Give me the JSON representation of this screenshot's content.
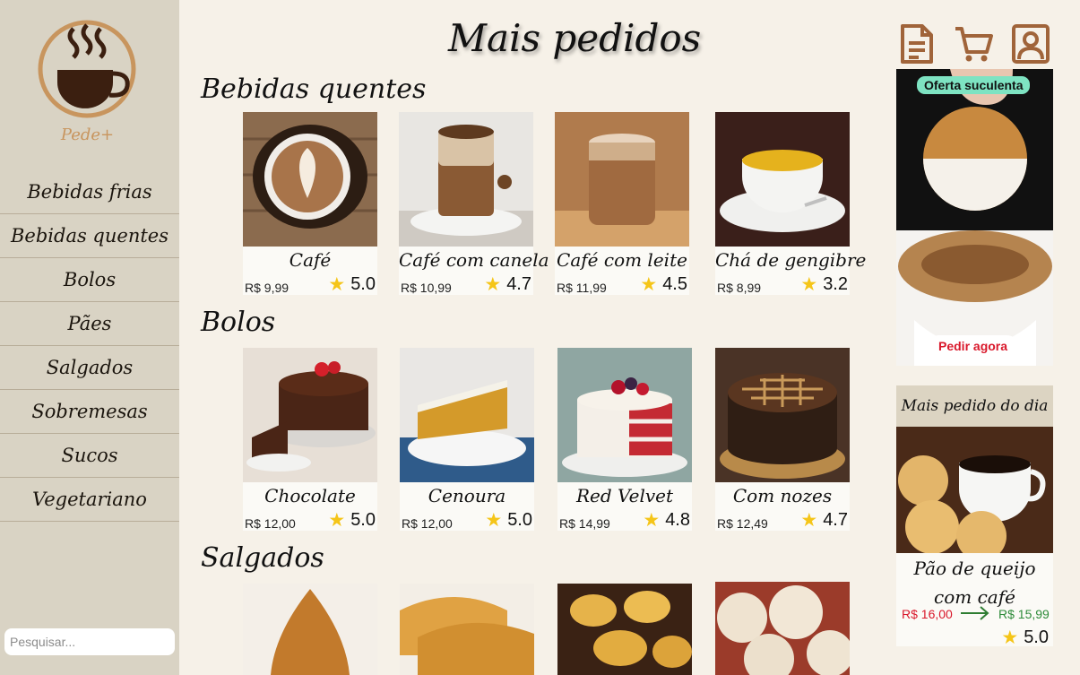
{
  "brand": {
    "name": "Pede+"
  },
  "sidebar": {
    "items": [
      {
        "label": "Bebidas frias"
      },
      {
        "label": "Bebidas quentes"
      },
      {
        "label": "Bolos"
      },
      {
        "label": "Pães"
      },
      {
        "label": "Salgados"
      },
      {
        "label": "Sobremesas"
      },
      {
        "label": "Sucos"
      },
      {
        "label": "Vegetariano"
      }
    ],
    "search_placeholder": "Pesquisar..."
  },
  "header": {
    "title": "Mais pedidos",
    "icons": [
      "document-icon",
      "cart-icon",
      "user-icon"
    ]
  },
  "sections": [
    {
      "title": "Bebidas quentes",
      "products": [
        {
          "name": "Café",
          "price": "R$ 9,99",
          "rating": "5.0",
          "image": "latte-art-cup"
        },
        {
          "name": "Café com canela",
          "price": "R$ 10,99",
          "rating": "4.7",
          "image": "cinnamon-coffee-glass"
        },
        {
          "name": "Café com leite",
          "price": "R$ 11,99",
          "rating": "4.5",
          "image": "coffee-with-milk-glass"
        },
        {
          "name": "Chá de gengibre",
          "price": "R$ 8,99",
          "rating": "3.2",
          "image": "ginger-tea-cup"
        }
      ]
    },
    {
      "title": "Bolos",
      "products": [
        {
          "name": "Chocolate",
          "price": "R$ 12,00",
          "rating": "5.0",
          "image": "chocolate-cake"
        },
        {
          "name": "Cenoura",
          "price": "R$ 12,00",
          "rating": "5.0",
          "image": "carrot-cake-slice"
        },
        {
          "name": "Red Velvet",
          "price": "R$ 14,99",
          "rating": "4.8",
          "image": "red-velvet-cake"
        },
        {
          "name": "Com nozes",
          "price": "R$ 12,49",
          "rating": "4.7",
          "image": "walnut-cake"
        }
      ]
    },
    {
      "title": "Salgados",
      "products": [
        {
          "name": "",
          "price": "",
          "rating": "",
          "image": "coxinha"
        },
        {
          "name": "",
          "price": "",
          "rating": "",
          "image": "pastel"
        },
        {
          "name": "",
          "price": "",
          "rating": "",
          "image": "empadinha"
        },
        {
          "name": "",
          "price": "",
          "rating": "",
          "image": "pao-de-queijo"
        }
      ]
    }
  ],
  "promo": {
    "badge": "Oferta suculenta",
    "button": "Pedir agora",
    "image": "cookie-dipped-in-coffee"
  },
  "daily": {
    "heading": "Mais pedido do dia",
    "name": "Pão de queijo com café",
    "old_price": "R$ 16,00",
    "new_price": "R$ 15,99",
    "rating": "5.0",
    "image": "cheese-bread-and-coffee"
  },
  "colors": {
    "sidebar_bg": "#d9d3c4",
    "page_bg": "#f6f1e8",
    "accent_brown": "#a0643a",
    "star": "#f5c518",
    "old_price": "#d9182b",
    "new_price": "#2e8b3a",
    "badge": "#7ee3c2"
  }
}
